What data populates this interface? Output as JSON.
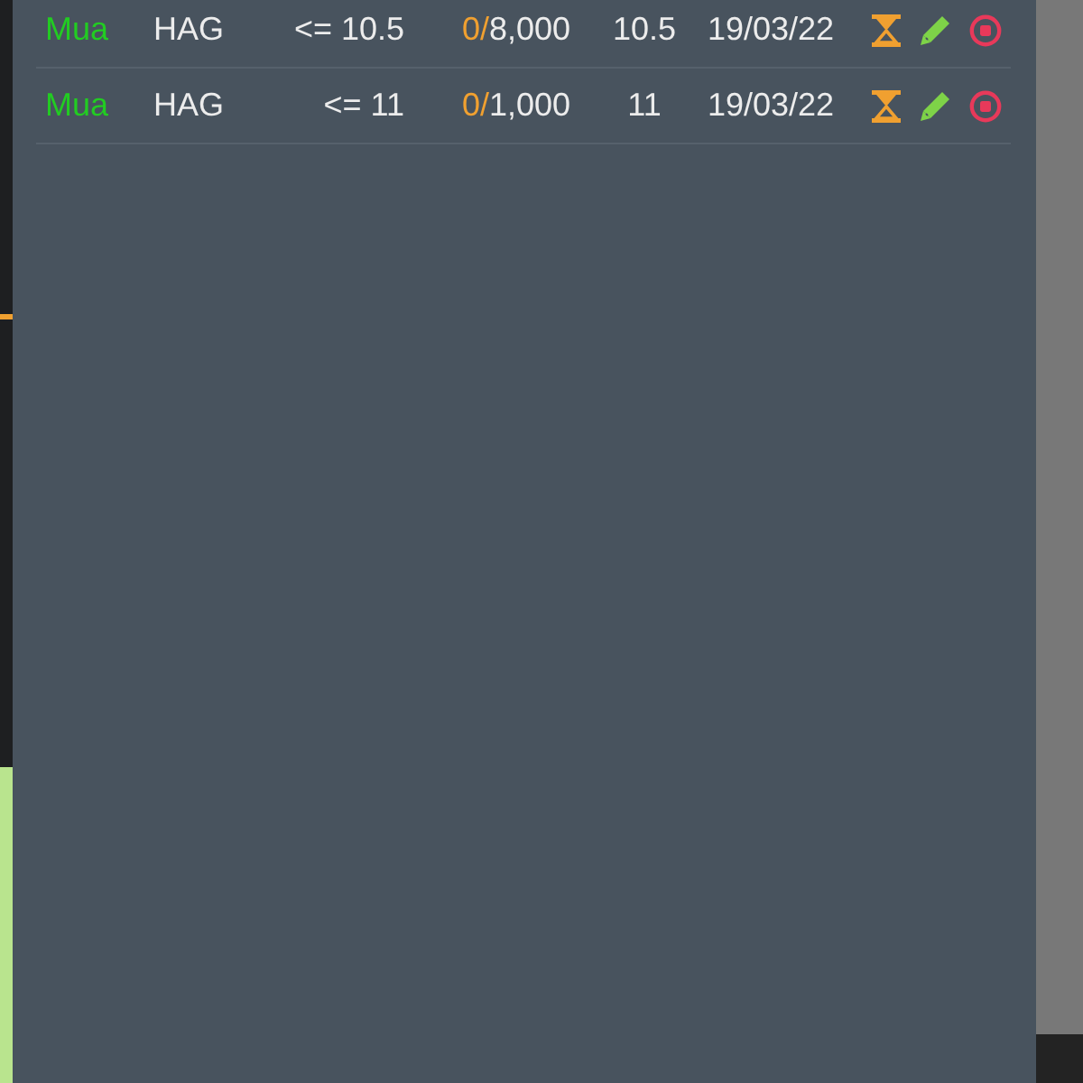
{
  "orders": {
    "rows": [
      {
        "side": "Mua",
        "color": "#22cc22",
        "symbol": "HAG",
        "condition": "<= 10.5",
        "matched": "0/",
        "quantity": "8,000",
        "price": "10.5",
        "date": "19/03/22"
      },
      {
        "side": "Mua",
        "color": "#22cc22",
        "symbol": "HAG",
        "condition": "<= 11",
        "matched": "0/",
        "quantity": "1,000",
        "price": "11",
        "date": "19/03/22"
      }
    ]
  }
}
